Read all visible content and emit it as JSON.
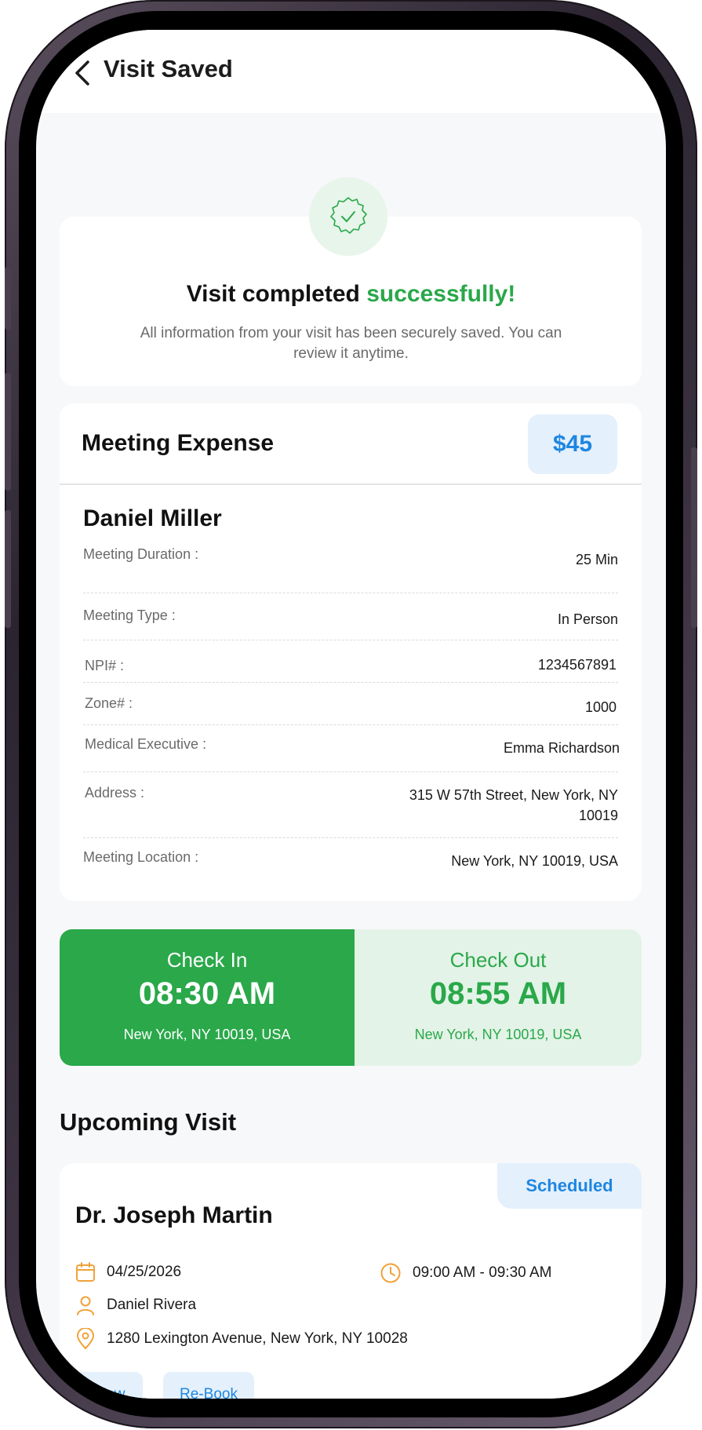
{
  "header": {
    "title": "Visit Saved"
  },
  "success": {
    "title_prefix": "Visit completed ",
    "title_accent": "successfully!",
    "message": "All information from your visit has been securely saved. You can review it anytime."
  },
  "expense": {
    "title": "Meeting Expense",
    "amount": "$45",
    "person": "Daniel Miller",
    "rows": [
      {
        "label": "Meeting Duration :",
        "value": "25 Min"
      },
      {
        "label": "Meeting Type :",
        "value": "In Person"
      },
      {
        "label": "NPI# :",
        "value": "1234567891"
      },
      {
        "label": "Zone# :",
        "value": "1000"
      },
      {
        "label": "Medical Executive :",
        "value": "Emma Richardson"
      },
      {
        "label": "Address :",
        "value": "315 W 57th Street, New York, NY 10019"
      },
      {
        "label": "Meeting Location :",
        "value": "New York, NY 10019, USA"
      }
    ]
  },
  "checkin": {
    "label": "Check In",
    "time": "08:30 AM",
    "location": "New York, NY 10019, USA"
  },
  "checkout": {
    "label": "Check Out",
    "time": "08:55 AM",
    "location": "New York, NY 10019, USA"
  },
  "upcoming": {
    "title": "Upcoming Visit",
    "status": "Scheduled",
    "doctor": "Dr. Joseph Martin",
    "date": "04/25/2026",
    "time": "09:00 AM - 09:30 AM",
    "rep": "Daniel Rivera",
    "address": "1280 Lexington Avenue, New York, NY 10028",
    "view_label": "View",
    "rebook_label": "Re-Book"
  },
  "colors": {
    "accent_green": "#2aa84a",
    "accent_blue": "#1f86e0",
    "icon_orange": "#f0a23a"
  }
}
